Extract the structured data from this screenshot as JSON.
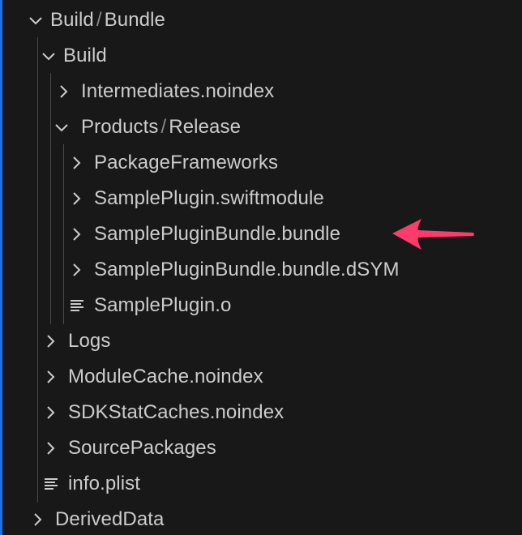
{
  "tree": {
    "build_bundle": {
      "part1": "Build",
      "separator": "/",
      "part2": "Bundle"
    },
    "build": {
      "label": "Build"
    },
    "intermediates": {
      "label": "Intermediates.noindex"
    },
    "products_release": {
      "part1": "Products",
      "separator": "/",
      "part2": "Release"
    },
    "package_frameworks": {
      "label": "PackageFrameworks"
    },
    "swiftmodule": {
      "label": "SamplePlugin.swiftmodule"
    },
    "bundle": {
      "label": "SamplePluginBundle.bundle"
    },
    "bundle_dsym": {
      "label": "SamplePluginBundle.bundle.dSYM"
    },
    "plugin_o": {
      "label": "SamplePlugin.o"
    },
    "logs": {
      "label": "Logs"
    },
    "module_cache": {
      "label": "ModuleCache.noindex"
    },
    "sdk_stat_caches": {
      "label": "SDKStatCaches.noindex"
    },
    "source_packages": {
      "label": "SourcePackages"
    },
    "info_plist": {
      "label": "info.plist"
    },
    "derived_data": {
      "label": "DerivedData"
    }
  },
  "icons": {
    "expanded": "chevron-down-icon",
    "collapsed": "chevron-right-icon",
    "file": "file-lines-icon",
    "annotation": "pointer-arrow-icon"
  },
  "colors": {
    "background": "#181818",
    "text": "#cccccc",
    "indent_guide": "#4a4a4a",
    "annotation_arrow": "#ff3b6b",
    "focus_edge": "#1f6feb"
  }
}
